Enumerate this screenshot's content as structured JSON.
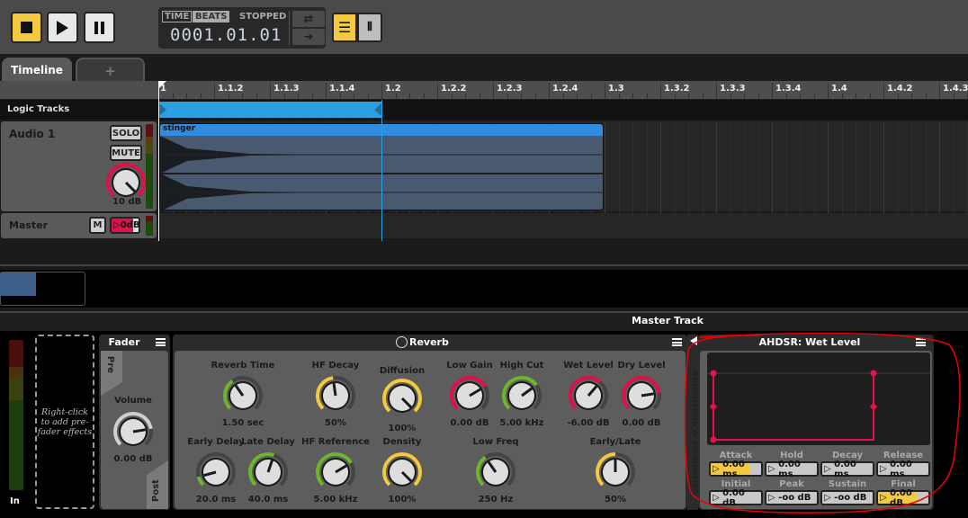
{
  "transport": {
    "stop_icon": "stop-icon",
    "play_icon": "play-icon",
    "pause_icon": "pause-icon",
    "time_label": "TIME",
    "beats_label": "BEATS",
    "status": "STOPPED",
    "position": "0001.01.01",
    "loop_icon": "loop-icon",
    "follow_icon": "arrow-right-icon"
  },
  "tabs": [
    {
      "label": "Timeline"
    },
    {
      "label": "+"
    }
  ],
  "ruler": [
    "1",
    "1.1.2",
    "1.1.3",
    "1.1.4",
    "1.2",
    "1.2.2",
    "1.2.3",
    "1.2.4",
    "1.3",
    "1.3.2",
    "1.3.3",
    "1.3.4",
    "1.4",
    "1.4.2",
    "1.4.3"
  ],
  "logic_tracks": {
    "label": "Logic Tracks"
  },
  "tracks": [
    {
      "name": "Audio 1",
      "solo": "SOLO",
      "mute": "MUTE",
      "gain": "10 dB",
      "gain_fraction": 1.0
    },
    {
      "name": "Master",
      "mute": "M",
      "level": "0dB"
    }
  ],
  "clip": {
    "name": "stinger"
  },
  "master_track": {
    "title": "Master Track"
  },
  "input": {
    "label": "In"
  },
  "prefader": {
    "hint": "Right-click to add pre-fader effects"
  },
  "fader": {
    "title": "Fader",
    "pre": "Pre",
    "post": "Post",
    "volume": {
      "label": "Volume",
      "value": "0.00 dB",
      "fraction": 0.8,
      "color": "#cfcfcf"
    }
  },
  "reverb": {
    "title": "Reverb",
    "knobs": [
      {
        "label": "Reverb Time",
        "value": "1.50 sec",
        "fraction": 0.37,
        "color": "#6fb52c"
      },
      {
        "label": "HF Decay",
        "value": "50%",
        "fraction": 0.47,
        "color": "#f3c93f"
      },
      {
        "label": "Diffusion",
        "value": "100%",
        "fraction": 1.0,
        "color": "#f3c93f"
      },
      {
        "label": "Low Gain",
        "value": "0.00 dB",
        "fraction": 0.72,
        "color": "#e0104a"
      },
      {
        "label": "High Cut",
        "value": "5.00 kHz",
        "fraction": 0.7,
        "color": "#6fb52c"
      },
      {
        "label": "Wet Level",
        "value": "-6.00 dB",
        "fraction": 0.65,
        "color": "#e0104a"
      },
      {
        "label": "Dry Level",
        "value": "0.00 dB",
        "fraction": 0.8,
        "color": "#e0104a"
      },
      {
        "label": "Early Delay",
        "value": "20.0 ms",
        "fraction": 0.11,
        "color": "#6fb52c"
      },
      {
        "label": "Late Delay",
        "value": "40.0 ms",
        "fraction": 0.57,
        "color": "#6fb52c"
      },
      {
        "label": "HF Reference",
        "value": "5.00 kHz",
        "fraction": 0.72,
        "color": "#6fb52c"
      },
      {
        "label": "Density",
        "value": "100%",
        "fraction": 1.0,
        "color": "#f3c93f"
      },
      {
        "label": "Low Freq",
        "value": "250 Hz",
        "fraction": 0.37,
        "color": "#6fb52c"
      },
      {
        "label": "Early/Late",
        "value": "50%",
        "fraction": 0.5,
        "color": "#f3c93f"
      }
    ]
  },
  "side_tab": {
    "label": "Automation & Modulation"
  },
  "ahdsr": {
    "title": "AHDSR: Wet Level",
    "fields": [
      {
        "label": "Attack",
        "value": "0.00 ms"
      },
      {
        "label": "Hold",
        "value": "0.00 ms"
      },
      {
        "label": "Decay",
        "value": "0.00 ms"
      },
      {
        "label": "Release",
        "value": "0.00 ms"
      },
      {
        "label": "Initial",
        "value": "0.00 dB"
      },
      {
        "label": "Peak",
        "value": "-oo dB"
      },
      {
        "label": "Sustain",
        "value": "-oo dB"
      },
      {
        "label": "Final",
        "value": "0.00 dB"
      }
    ],
    "color": "#e8104a"
  }
}
